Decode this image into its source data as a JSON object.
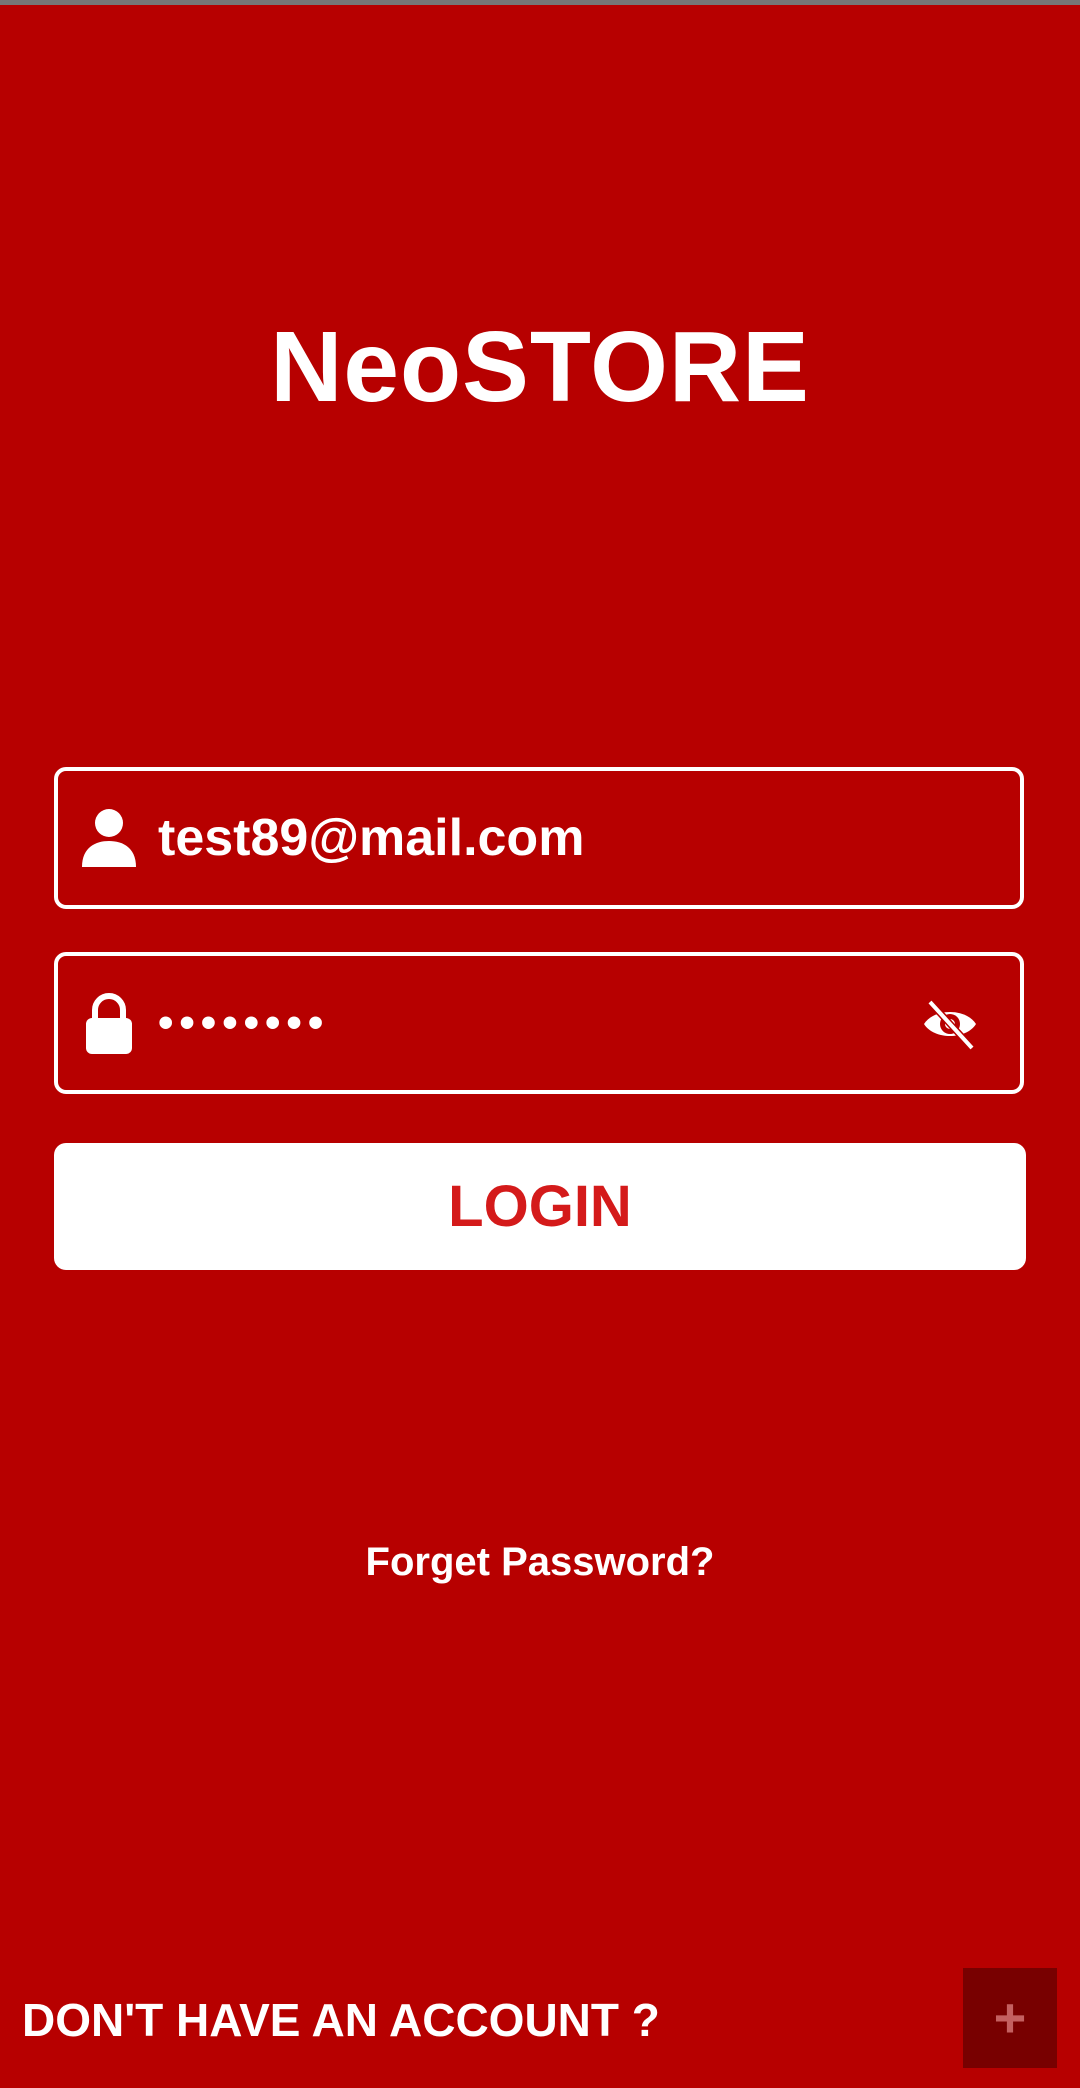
{
  "app": {
    "title": "NeoSTORE",
    "accent_color": "#b70000",
    "button_text_color": "#d41a1a"
  },
  "login_form": {
    "email": {
      "value": "test89@mail.com",
      "icon": "person-icon"
    },
    "password": {
      "masked_value": "••••••••",
      "icon": "lock-icon",
      "toggle_icon": "eye-off-icon"
    },
    "login_label": "LOGIN",
    "forgot_label": "Forget Password?"
  },
  "footer": {
    "signup_prompt": "DON'T HAVE AN ACCOUNT ?",
    "add_icon": "plus-icon",
    "add_symbol": "+"
  }
}
